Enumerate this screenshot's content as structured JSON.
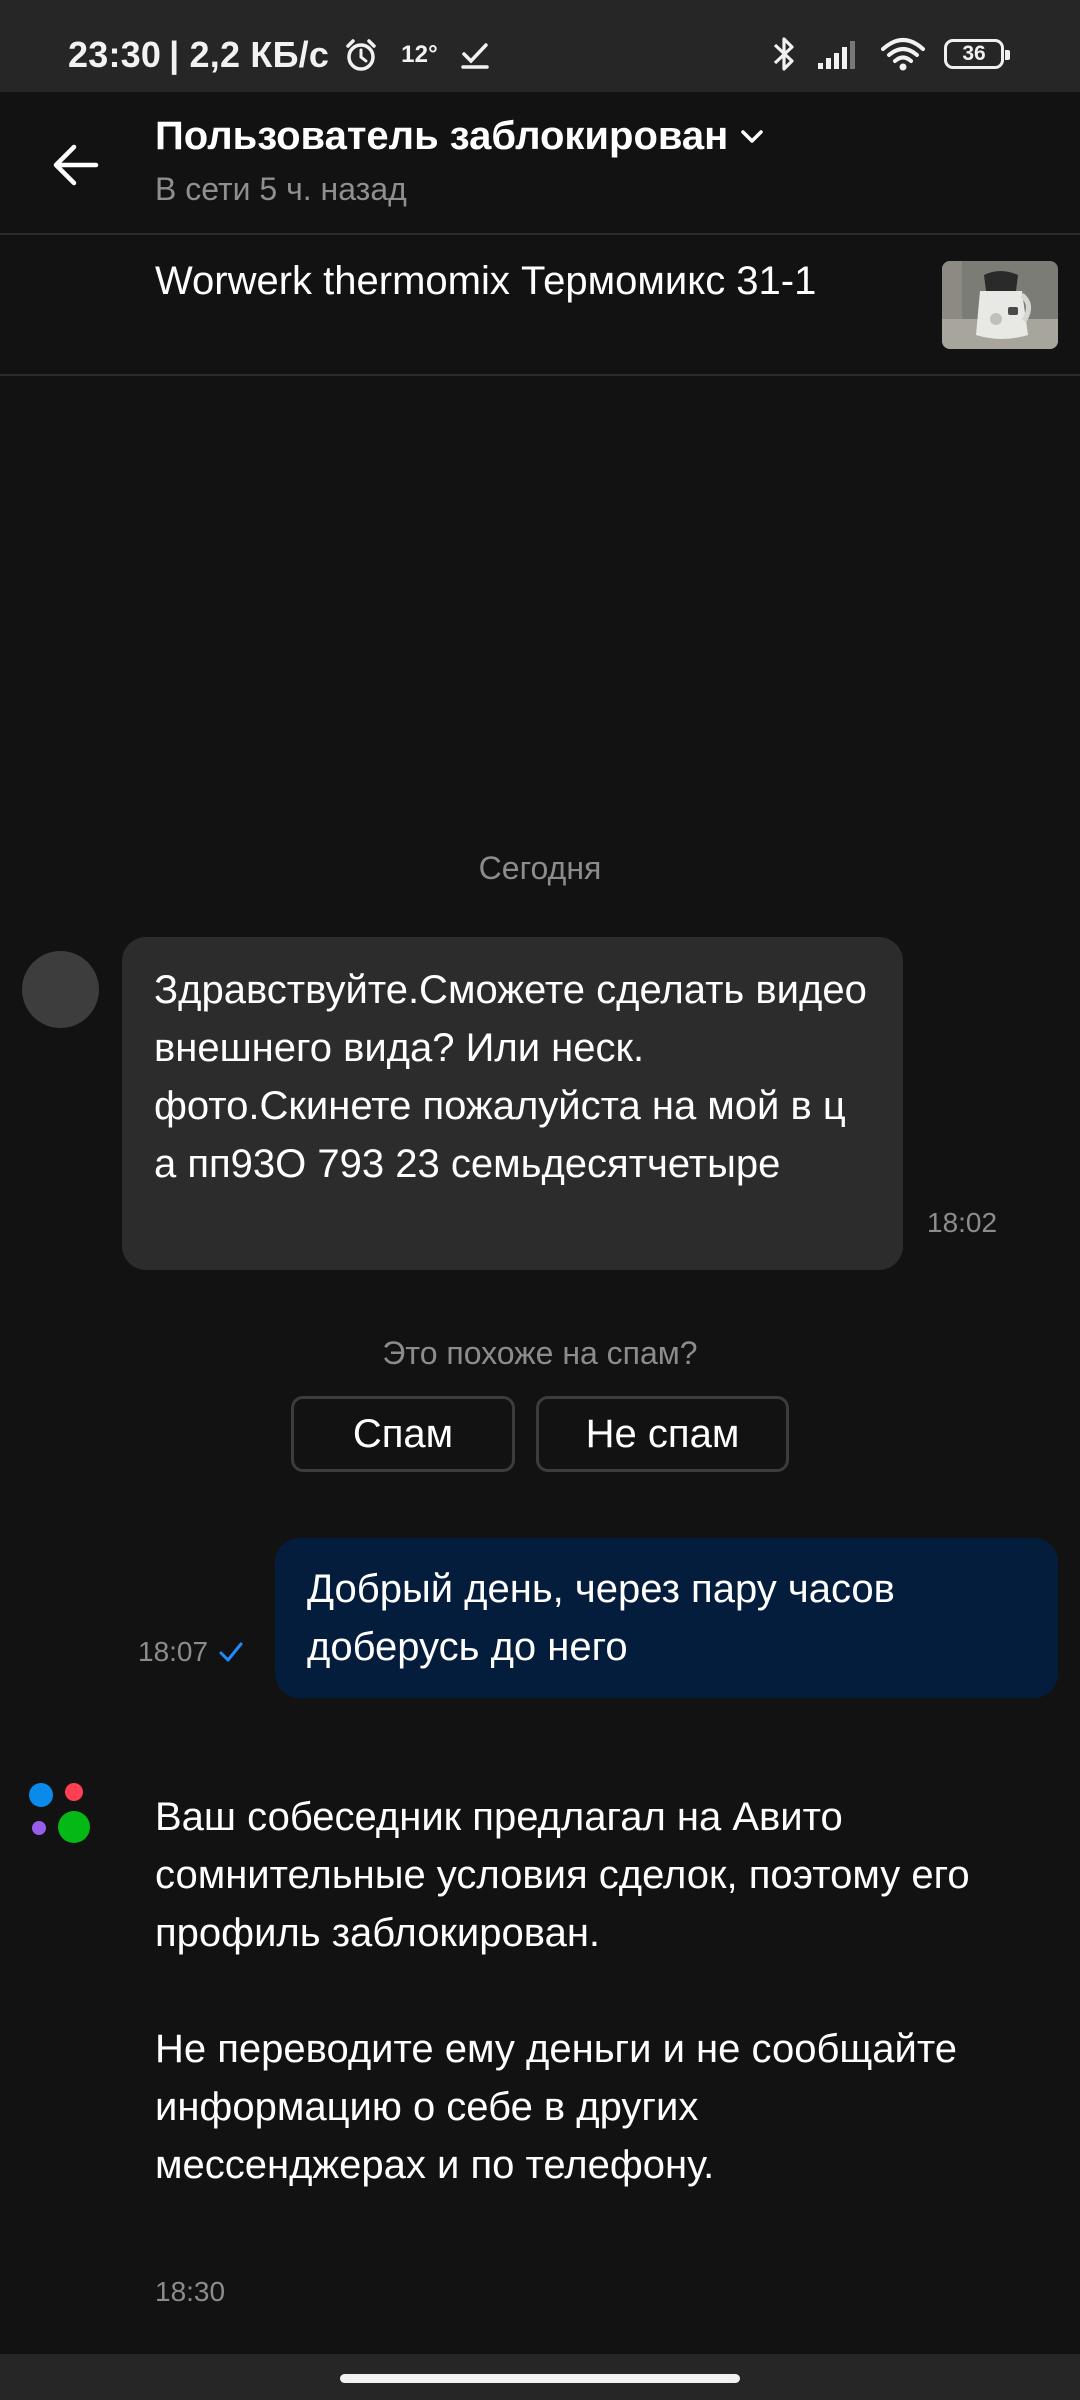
{
  "status_bar": {
    "time": "23:30",
    "net_speed": "| 2,2 КБ/с",
    "temperature": "12°",
    "battery": "36"
  },
  "header": {
    "title": "Пользователь заблокирован",
    "subtitle": "В сети 5 ч. назад"
  },
  "listing": {
    "title": "Worwerk thermomix Термомикс 31-1"
  },
  "chat": {
    "date_separator": "Сегодня",
    "incoming_message": {
      "text": "Здравствуйте.Сможете сделать видео внешнего вида? Или неск. фото.Скинете пожалуйста на мой в ц а пп93О 793 23 семьдесятчетыре",
      "time": "18:02"
    },
    "spam_prompt": {
      "question": "Это похоже на спам?",
      "spam_label": "Спам",
      "not_spam_label": "Не спам"
    },
    "outgoing_message": {
      "text": "Добрый день, через пару часов доберусь до него",
      "time": "18:07"
    },
    "system_message": {
      "paragraph_1": "Ваш собеседник предлагал на Авито сомнительные условия сделок, поэтому его профиль заблокирован.",
      "paragraph_2": "Не переводите ему деньги и не сообщайте информацию о себе в других мессенджерах и по телефону.",
      "time": "18:30"
    }
  },
  "colors": {
    "background": "#121212",
    "incoming_bubble": "#2c2c2c",
    "outgoing_bubble": "#051d3d",
    "read_check": "#1f8bff",
    "secondary_text": "#8c8c8c",
    "logo_blue": "#0a8bea",
    "logo_red": "#ff4053",
    "logo_purple": "#965eeb",
    "logo_green": "#04b916"
  }
}
